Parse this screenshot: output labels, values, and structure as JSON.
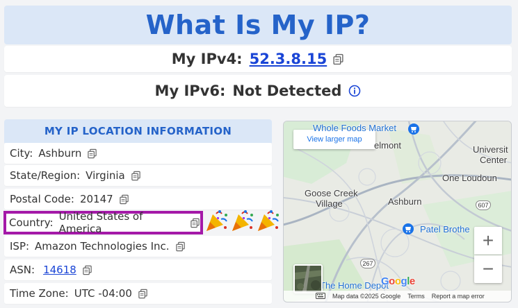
{
  "title": "What Is My IP?",
  "ipv4": {
    "label": "My IPv4:",
    "value": "52.3.8.15"
  },
  "ipv6": {
    "label": "My IPv6:",
    "value": "Not Detected"
  },
  "location": {
    "header": "MY IP LOCATION INFORMATION",
    "city": {
      "label": "City:",
      "value": "Ashburn"
    },
    "state": {
      "label": "State/Region:",
      "value": "Virginia"
    },
    "postal": {
      "label": "Postal Code:",
      "value": "20147"
    },
    "country": {
      "label": "Country:",
      "value": "United States of America"
    },
    "isp": {
      "label": "ISP:",
      "value": "Amazon Technologies Inc."
    },
    "asn": {
      "label": "ASN:",
      "value": "14618"
    },
    "timezone": {
      "label": "Time Zone:",
      "value": "UTC -04:00"
    }
  },
  "map": {
    "larger_map": "View larger map",
    "labels": {
      "whole_foods": "Whole Foods Market",
      "belmont": "elmont",
      "university": "Universit",
      "center": "Center",
      "one_loudoun": "One Loudoun",
      "goose_creek": "Goose Creek",
      "village": "Village",
      "ashburn": "Ashburn",
      "patel": "Patel Brothe",
      "home_depot": "The Home Depot",
      "route_607": "607",
      "route_267": "267"
    },
    "attribution": {
      "data": "Map data ©2025 Google",
      "terms": "Terms",
      "report": "Report a map error"
    },
    "zoom_in": "+",
    "zoom_out": "−",
    "google": [
      "G",
      "o",
      "o",
      "g",
      "l",
      "e"
    ]
  },
  "colors": {
    "accent": "#2563c9",
    "link": "#1a45d6",
    "highlight": "#a419a8",
    "header_bg": "#dbe7f7"
  },
  "icons": [
    "copy-icon",
    "info-icon",
    "party-popper-icon",
    "store-icon",
    "keyboard-icon"
  ]
}
